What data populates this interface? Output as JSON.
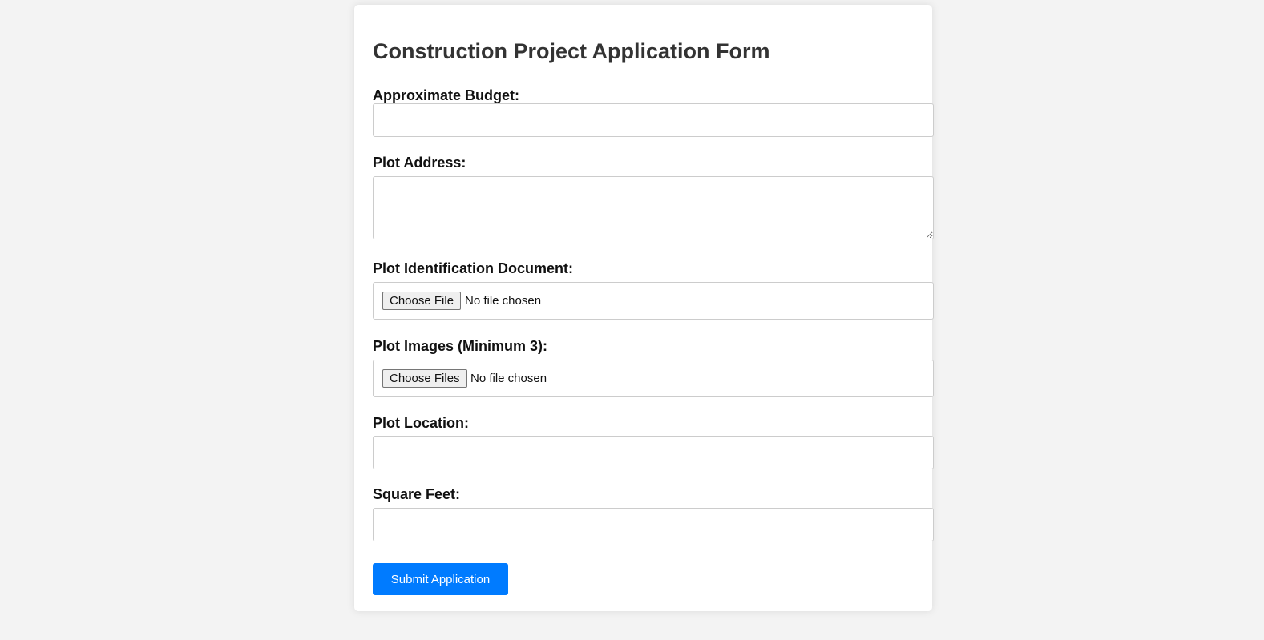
{
  "form": {
    "title": "Construction Project Application Form",
    "budget": {
      "label": "Approximate Budget:",
      "value": "",
      "placeholder": ""
    },
    "address": {
      "label": "Plot Address:",
      "value": "",
      "placeholder": ""
    },
    "identification_document": {
      "label": "Plot Identification Document:",
      "button_label": "Choose File",
      "status": "No file chosen"
    },
    "images": {
      "label": "Plot Images (Minimum 3):",
      "button_label": "Choose Files",
      "status": "No file chosen"
    },
    "location": {
      "label": "Plot Location:",
      "value": "",
      "placeholder": ""
    },
    "square_feet": {
      "label": "Square Feet:",
      "value": "",
      "placeholder": ""
    },
    "submit_label": "Submit Application"
  },
  "colors": {
    "page_background": "#f3f3f3",
    "card_background": "#ffffff",
    "accent": "#007bff",
    "title_text": "#333333",
    "border": "#cccccc"
  }
}
